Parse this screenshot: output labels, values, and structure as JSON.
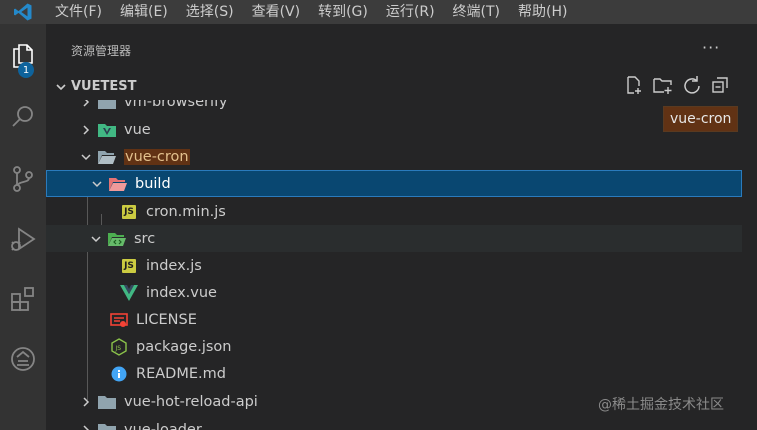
{
  "menu": {
    "items": [
      {
        "label": "文件(F)"
      },
      {
        "label": "编辑(E)"
      },
      {
        "label": "选择(S)"
      },
      {
        "label": "查看(V)"
      },
      {
        "label": "转到(G)"
      },
      {
        "label": "运行(R)"
      },
      {
        "label": "终端(T)"
      },
      {
        "label": "帮助(H)"
      }
    ]
  },
  "activity_bar": {
    "explorer_badge": "1",
    "icons": [
      "files-icon",
      "search-icon",
      "source-control-icon",
      "run-debug-icon",
      "extensions-icon",
      "remote-icon"
    ]
  },
  "explorer": {
    "title": "资源管理器",
    "more_label": "···",
    "section": {
      "title": "VUETEST",
      "actions": [
        "new-file-icon",
        "new-folder-icon",
        "refresh-icon",
        "collapse-all-icon"
      ]
    },
    "tree": [
      {
        "label": "vm-browserify",
        "type": "folder",
        "depth": 0,
        "expanded": false
      },
      {
        "label": "vue",
        "type": "folder-vue",
        "depth": 0,
        "expanded": false
      },
      {
        "label": "vue-cron",
        "type": "folder-open",
        "depth": 0,
        "expanded": true,
        "highlighted": true
      },
      {
        "label": "build",
        "type": "folder-build",
        "depth": 1,
        "expanded": true,
        "selected": true
      },
      {
        "label": "cron.min.js",
        "type": "js",
        "depth": 2
      },
      {
        "label": "src",
        "type": "folder-src",
        "depth": 1,
        "expanded": true
      },
      {
        "label": "index.js",
        "type": "js",
        "depth": 2
      },
      {
        "label": "index.vue",
        "type": "vue",
        "depth": 2
      },
      {
        "label": "LICENSE",
        "type": "license",
        "depth": 1
      },
      {
        "label": "package.json",
        "type": "node",
        "depth": 1
      },
      {
        "label": "README.md",
        "type": "info",
        "depth": 1
      },
      {
        "label": "vue-hot-reload-api",
        "type": "folder",
        "depth": 0,
        "expanded": false
      },
      {
        "label": "vue-loader",
        "type": "folder",
        "depth": 0,
        "expanded": false
      }
    ]
  },
  "tooltip": {
    "text": "vue-cron"
  },
  "watermark": {
    "text": "@稀土掘金技术社区"
  },
  "colors": {
    "accent": "#0e639c",
    "selection": "#094771",
    "highlight_bg": "#613214",
    "vue_green": "#41b883",
    "js_yellow": "#cbcb41"
  }
}
